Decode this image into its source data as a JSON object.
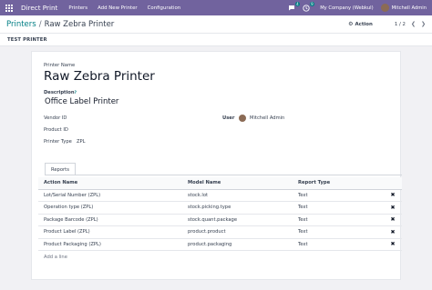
{
  "navbar": {
    "app_name": "Direct Print",
    "menu": [
      "Printers",
      "Add New Printer",
      "Configuration"
    ],
    "chat_badge": "4",
    "activity_badge": "9",
    "company": "My Company (Webkul)",
    "user": "Mitchell Admin"
  },
  "breadcrumb": {
    "parent": "Printers",
    "separator": "/",
    "current": "Raw Zebra Printer"
  },
  "control": {
    "action_label": "Action",
    "pager": "1 / 2"
  },
  "statusbar": {
    "test_label": "TEST PRINTER"
  },
  "form": {
    "name_label": "Printer Name",
    "name_value": "Raw Zebra Printer",
    "description_label": "Description",
    "description_help": "?",
    "description_value": "Office Label Printer",
    "vendor_label": "Vendor ID",
    "product_label": "Product ID",
    "type_label": "Printer Type",
    "type_value": "ZPL",
    "user_label": "User",
    "user_value": "Mitchell Admin"
  },
  "reports": {
    "tab_label": "Reports",
    "columns": [
      "Action Name",
      "Model Name",
      "Report Type"
    ],
    "rows": [
      {
        "action": "Lot/Serial Number (ZPL)",
        "model": "stock.lot",
        "type": "Text"
      },
      {
        "action": "Operation type (ZPL)",
        "model": "stock.picking.type",
        "type": "Text"
      },
      {
        "action": "Package Barcode (ZPL)",
        "model": "stock.quant.package",
        "type": "Text"
      },
      {
        "action": "Product Label (ZPL)",
        "model": "product.product",
        "type": "Text"
      },
      {
        "action": "Product Packaging (ZPL)",
        "model": "product.packaging",
        "type": "Text"
      }
    ],
    "add_line": "Add a line"
  },
  "colors": {
    "navbar": "#71639e",
    "accent": "#017e84"
  }
}
